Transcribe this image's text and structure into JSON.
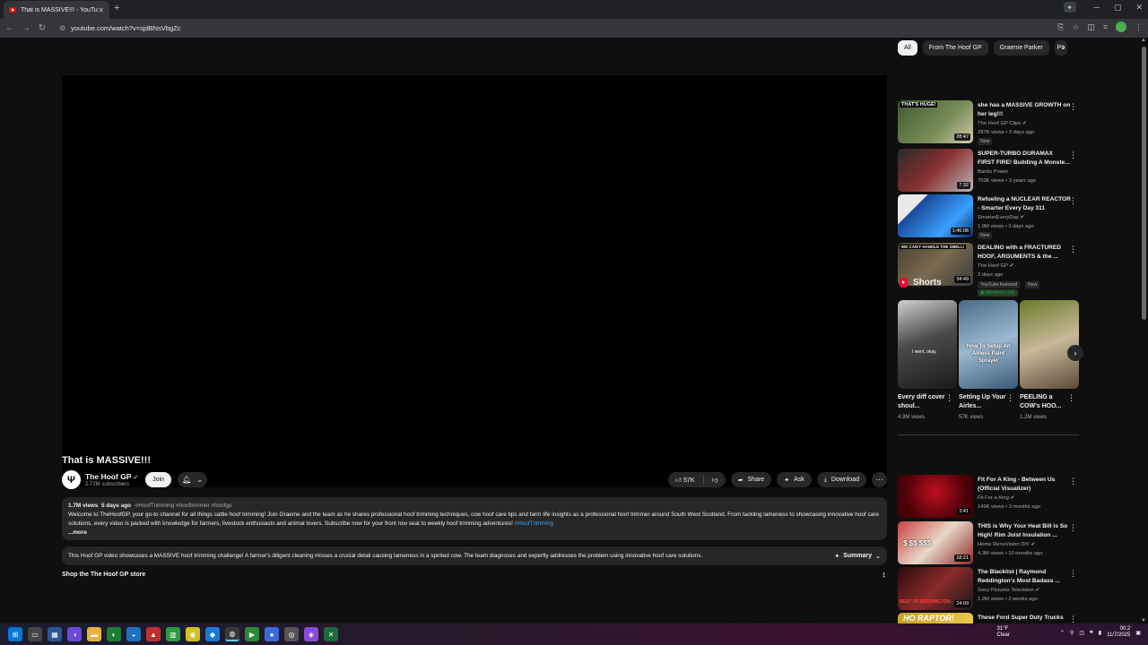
{
  "browser": {
    "tab_title": "That is MASSIVE!!! - YouTube",
    "url": "youtube.com/watch?v=sjdBNsVbgZc"
  },
  "video": {
    "title": "That is MASSIVE!!!",
    "channel": {
      "name": "The Hoof GP",
      "subscribers": "2.72M subscribers",
      "join_label": "Join"
    },
    "actions": {
      "likes": "57K",
      "share": "Share",
      "ask": "Ask",
      "download": "Download"
    },
    "description": {
      "views": "1.7M views",
      "date": "5 days ago",
      "tags": "#HoofTrimming #hooftrimmer #hoofgp",
      "text": "Welcome to TheHoofGP, your go-to channel for all things cattle hoof trimming! Join Graeme and the team as he shares professional hoof trimming techniques, cow hoof care tips and farm life insights as a professional hoof trimmer around South West Scotland. From tackling lameness to showcasing innovative hoof care solutions, every video is packed with knowledge for farmers, livestock enthusiasts and animal lovers. Subscribe now for your front row seat to weekly hoof trimming adventures!",
      "hashtag_link": "#HoofTrimming",
      "more": "...more"
    },
    "summary": {
      "text": "This Hoof GP video showcases a MASSIVE hoof trimming challenge! A farmer's diligent cleaning misses a crucial detail causing lameness in a spirited cow. The team diagnoses and expertly addresses the problem using innovative hoof care solutions.",
      "button": "Summary"
    },
    "store": "Shop the The Hoof GP store"
  },
  "sidebar": {
    "chips": [
      "All",
      "From The Hoof GP",
      "Graeme Parker",
      "Po"
    ],
    "recommendations": [
      {
        "title": "she has a MASSIVE GROWTH on her leg!!!",
        "channel": "The Hoof GP Clips",
        "verified": true,
        "meta": "287K views • 3 days ago",
        "badge": "New",
        "duration": "28:47",
        "thumb_color": "#4a6b3a",
        "thumb_text": "THAT'S HUGE!"
      },
      {
        "title": "SUPER-TURBO DURAMAX FIRST FIRE! Building A Monste...",
        "channel": "Banks Power",
        "verified": false,
        "meta": "703K views • 3 years ago",
        "badge": "",
        "duration": "7:32",
        "thumb_color": "#5b2b2b",
        "thumb_text": ""
      },
      {
        "title": "Refueling a NUCLEAR REACTOR - Smarter Every Day 311",
        "channel": "SmarterEveryDay",
        "verified": true,
        "meta": "1.9M views • 3 days ago",
        "badge": "New",
        "duration": "1:46:08",
        "thumb_color": "#1f4f8f",
        "thumb_text": ""
      },
      {
        "title": "DEALING with a FRACTURED HOOF, ARGUMENTS & the ...",
        "channel": "The Hoof GP",
        "verified": true,
        "meta": "3 days ago",
        "badge": "YouTube featured",
        "badge2": "New",
        "members": "Members only",
        "duration": "34:49",
        "thumb_color": "#5a5040",
        "thumb_text": "WE CAN'T HANDLE THE SMELL!"
      }
    ],
    "shorts_heading": "Shorts",
    "shorts": [
      {
        "title": "Every diff cover shoul...",
        "views": "4.9M views",
        "thumb_color": "#3a3a3a",
        "caption": "I went, okay."
      },
      {
        "title": "Setting Up Your Airles...",
        "views": "57K views",
        "thumb_color": "#6d8ea6",
        "caption": "How To Setup An Airless Paint Sprayer"
      },
      {
        "title": "PEELING a COW's HOO...",
        "views": "1.2M views",
        "thumb_color": "#7a8a3a",
        "caption": ""
      }
    ],
    "more_recommendations": [
      {
        "title": "Fit For A King - Between Us (Official Visualizer)",
        "channel": "Fit For a King",
        "verified": true,
        "meta": "146K views • 3 months ago",
        "duration": "3:41",
        "thumb_color": "#7a0a14"
      },
      {
        "title": "THIS is Why Your Heat Bill is So High! Rim Joist Insulation ...",
        "channel": "Home RenoVision DIY",
        "verified": true,
        "meta": "4.3M views • 10 months ago",
        "duration": "18:21",
        "thumb_color": "#8a2a2a",
        "thumb_text": "$ $$ $$$"
      },
      {
        "title": "The Blacklist | Raymond Reddington's Most Badass ...",
        "channel": "Sony Pictures Television",
        "verified": true,
        "meta": "1.2M views • 2 weeks ago",
        "duration": "24:09",
        "thumb_color": "#5a1a1a",
        "thumb_text": "BEST OF REDDINGTON"
      },
      {
        "title": "These Ford Super Duty Trucks",
        "channel": "",
        "verified": false,
        "meta": "",
        "duration": "",
        "thumb_color": "#c8a22a",
        "thumb_text": "HO RAPTOR!"
      }
    ]
  },
  "taskbar": {
    "temperature": "31°F",
    "weather": "Clear",
    "time": "00:2",
    "date": "11/7/2025"
  },
  "colors": {
    "background": "#0f0f0f",
    "surface": "#272727",
    "accent_red": "#ff0000",
    "link_blue": "#3ea6ff",
    "members_green": "#2ba640"
  }
}
